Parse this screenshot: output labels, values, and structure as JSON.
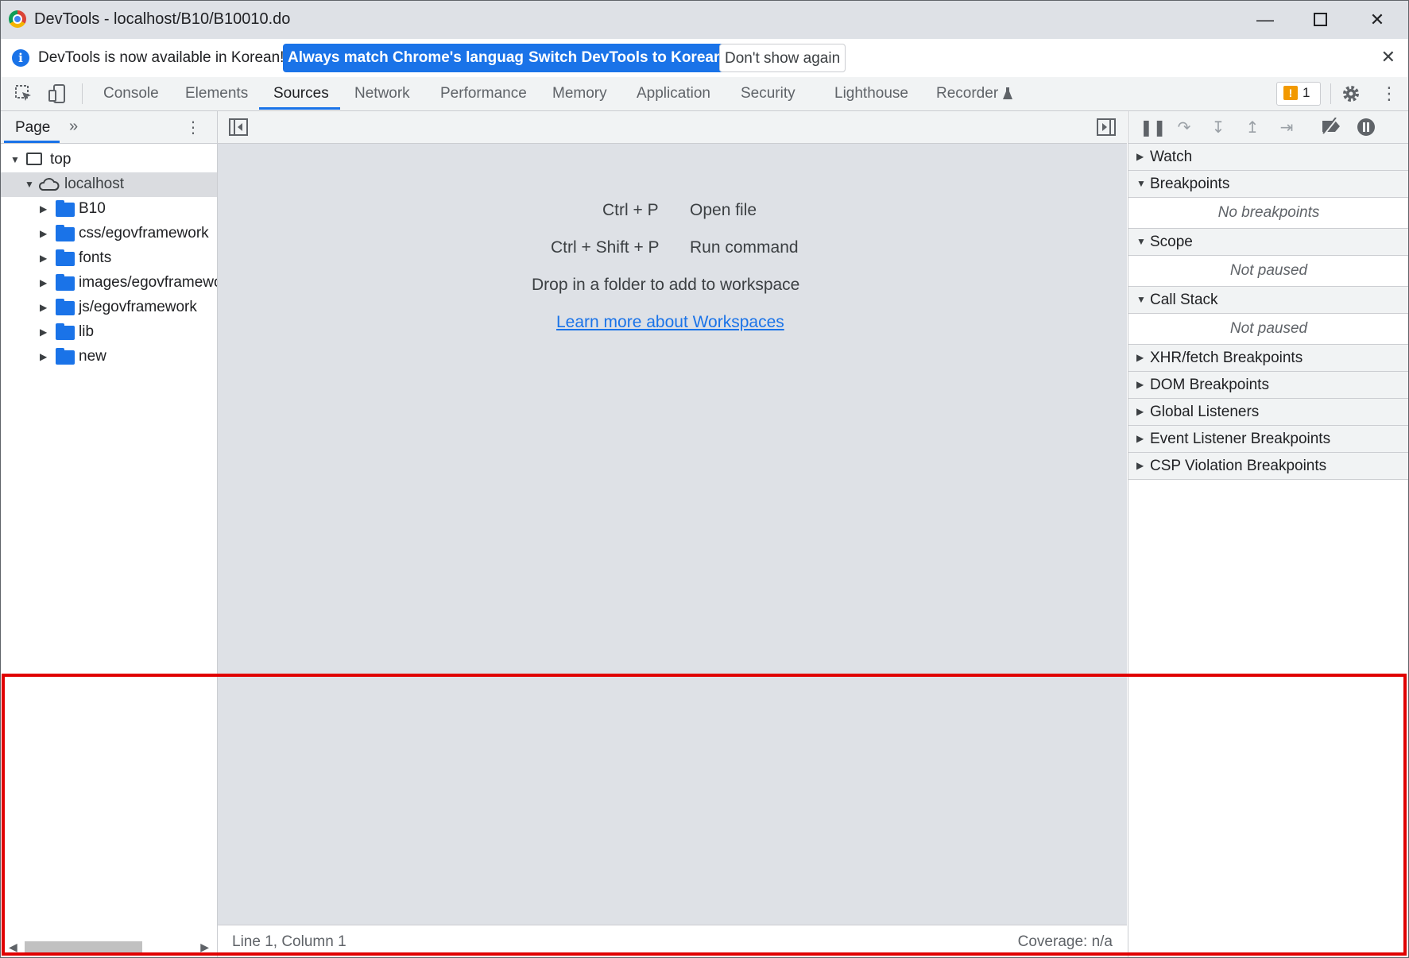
{
  "window": {
    "title": "DevTools - localhost/B10/B10010.do"
  },
  "infobar": {
    "message": "DevTools is now available in Korean!",
    "btn_match": "Always match Chrome's language",
    "btn_switch": "Switch DevTools to Korean",
    "btn_dismiss": "Don't show again"
  },
  "tabs": [
    "Console",
    "Elements",
    "Sources",
    "Network",
    "Performance",
    "Memory",
    "Application",
    "Security",
    "Lighthouse",
    "Recorder"
  ],
  "active_tab": "Sources",
  "issues_count": "1",
  "navigator": {
    "tab": "Page",
    "tree": {
      "top": "top",
      "host": "localhost",
      "folders": [
        "B10",
        "css/egovframework",
        "fonts",
        "images/egovframework",
        "js/egovframework",
        "lib",
        "new"
      ]
    }
  },
  "editor": {
    "shortcuts": [
      {
        "keys": "Ctrl + P",
        "action": "Open file"
      },
      {
        "keys": "Ctrl + Shift + P",
        "action": "Run command"
      }
    ],
    "drop_hint": "Drop in a folder to add to workspace",
    "learn_more": "Learn more about Workspaces",
    "status_position": "Line 1, Column 1",
    "status_coverage": "Coverage: n/a"
  },
  "debugger": {
    "sections": {
      "watch": "Watch",
      "breakpoints": "Breakpoints",
      "breakpoints_empty": "No breakpoints",
      "scope": "Scope",
      "scope_empty": "Not paused",
      "callstack": "Call Stack",
      "callstack_empty": "Not paused",
      "xhr": "XHR/fetch Breakpoints",
      "dom": "DOM Breakpoints",
      "global": "Global Listeners",
      "event": "Event Listener Breakpoints",
      "csp": "CSP Violation Breakpoints"
    }
  },
  "colors": {
    "accent": "#1a73e8",
    "highlight": "#e00000",
    "warning": "#f29900"
  }
}
